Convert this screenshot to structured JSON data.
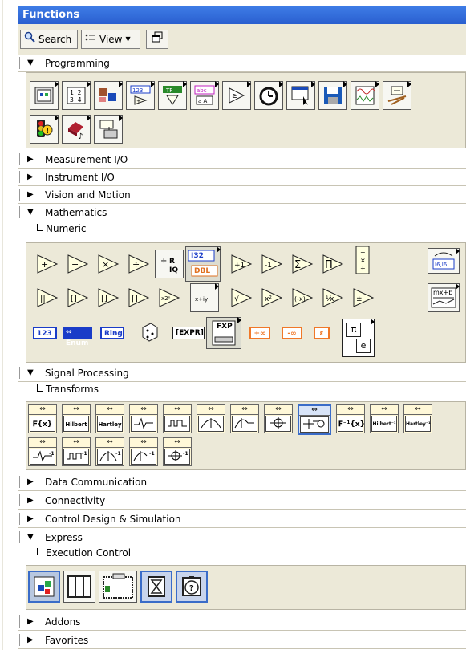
{
  "window": {
    "title": "Functions"
  },
  "toolbar": {
    "search_label": "Search",
    "view_label": "View"
  },
  "categories": {
    "programming": "Programming",
    "measurement_io": "Measurement I/O",
    "instrument_io": "Instrument I/O",
    "vision_motion": "Vision and Motion",
    "mathematics": "Mathematics",
    "signal_processing": "Signal Processing",
    "data_communication": "Data Communication",
    "connectivity": "Connectivity",
    "control_design": "Control Design & Simulation",
    "express": "Express",
    "addons": "Addons",
    "favorites": "Favorites"
  },
  "subcategories": {
    "numeric": "Numeric",
    "transforms": "Transforms",
    "execution_control": "Execution Control"
  },
  "numeric_labels": {
    "i32": "I32",
    "dbl": "DBL",
    "const_123": "123",
    "enum": "Enum",
    "ring": "Ring",
    "expr": "EXPR",
    "fxp": "FXP",
    "pos_inf": "+∞",
    "neg_inf": "-∞",
    "epsilon": "ε",
    "pi": "π",
    "e": "e",
    "mxb": "mx+b",
    "i16": "I6,I6"
  },
  "transform_labels": {
    "fft": "𝐅{x}",
    "hilbert": "Hilbert",
    "hartley": "Hartley",
    "ifft": "𝐅⁻¹{x}",
    "inv_hilbert": "Hilbert⁻¹",
    "inv_hartley": "Hartley⁻¹"
  },
  "colors": {
    "title_bar": "#2a5fd0",
    "toolbar_bg": "#ece9d8",
    "palette_bg": "#ece9d8",
    "blue_const": "#1a3cc8",
    "orange_const": "#f07828"
  }
}
